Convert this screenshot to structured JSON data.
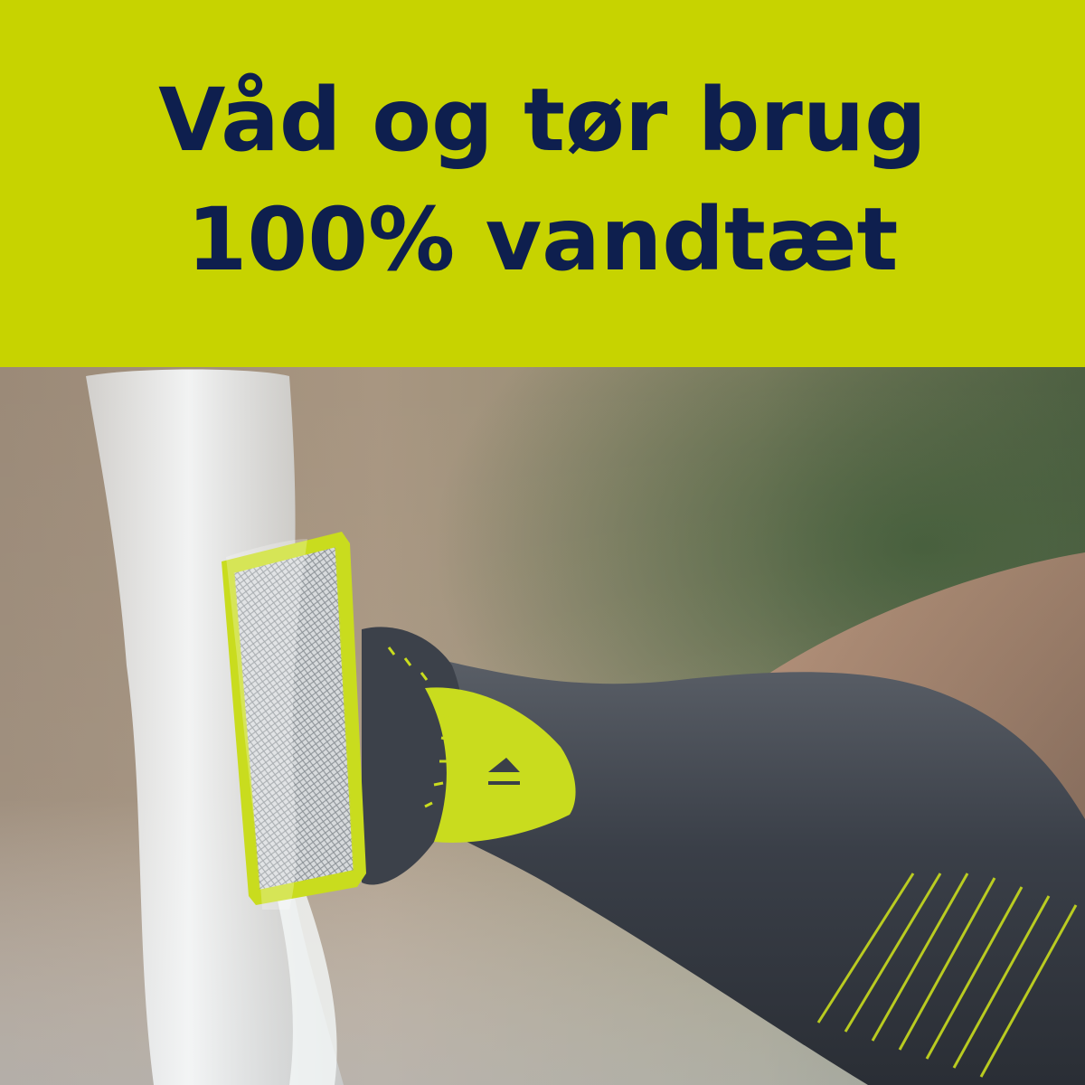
{
  "banner": {
    "line1": "Våd og tør brug",
    "line2": "100% vandtæt",
    "background_color": "#c7d300",
    "text_color": "#0e1f4e"
  },
  "photo": {
    "subject": "trimmer-under-running-water",
    "accent_color": "#c9dc1e",
    "body_color": "#3a3f48"
  }
}
